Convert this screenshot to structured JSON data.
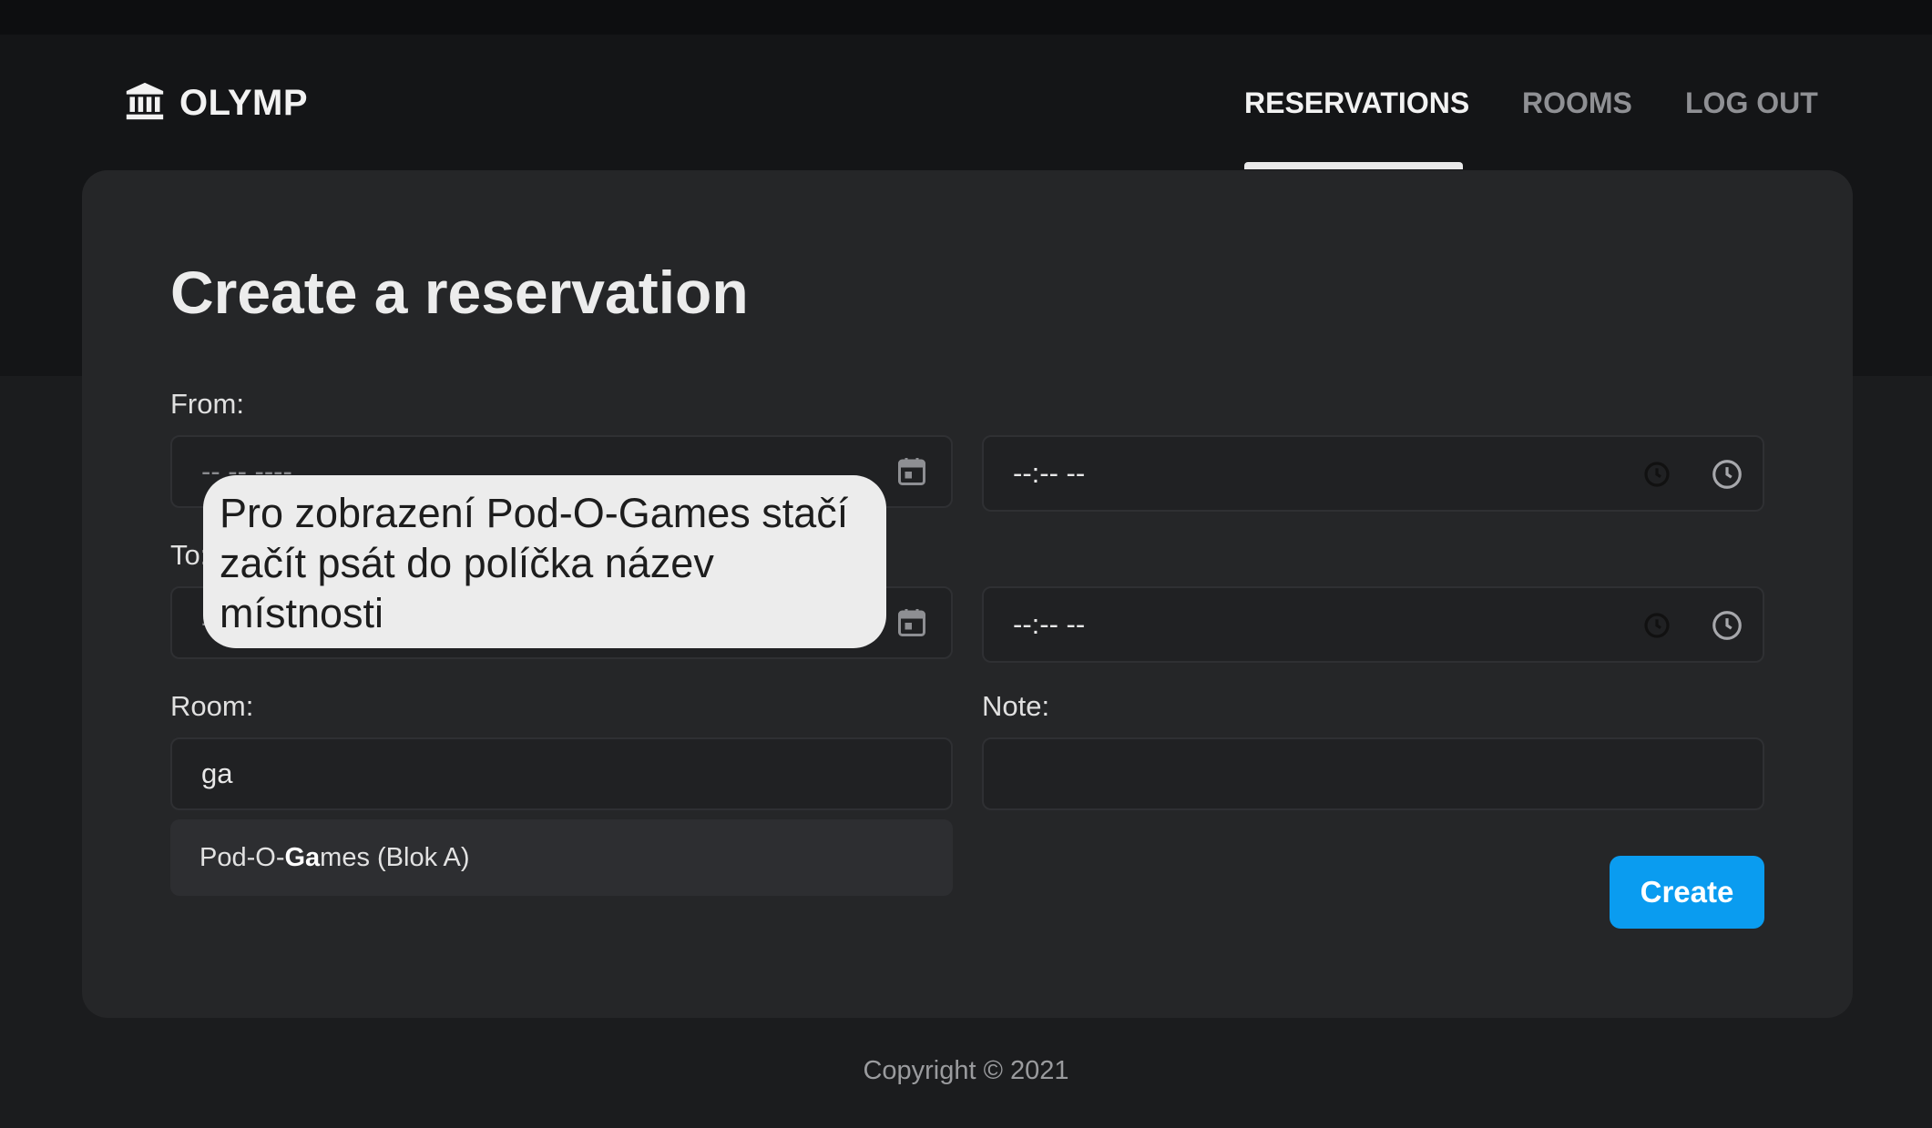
{
  "app": {
    "brand": "OLYMP",
    "brand_icon": "bank-building-icon"
  },
  "nav": {
    "items": [
      {
        "label": "RESERVATIONS",
        "active": true
      },
      {
        "label": "ROOMS",
        "active": false
      },
      {
        "label": "LOG OUT",
        "active": false
      }
    ]
  },
  "form": {
    "title": "Create a reservation",
    "from_label": "From:",
    "to_label": "To:",
    "room_label": "Room:",
    "note_label": "Note:",
    "from_date_placeholder": "-- -- ----",
    "from_time_placeholder": "--:-- --",
    "to_date_placeholder": "-- -- ----",
    "to_time_placeholder": "--:-- --",
    "room_value": "ga",
    "note_value": "",
    "suggestion": {
      "before": "Pod-O-",
      "match": "Ga",
      "after": "mes (Blok A)"
    },
    "create_label": "Create"
  },
  "tooltip": {
    "text": "Pro zobrazení Pod-O-Games stačí začít psát do políčka název místnosti"
  },
  "footer": {
    "copyright": "Copyright © 2021"
  },
  "colors": {
    "accent": "#0a9cf0",
    "background": "#1b1c1e",
    "card": "#252628",
    "tooltip_bg": "#ececec"
  }
}
